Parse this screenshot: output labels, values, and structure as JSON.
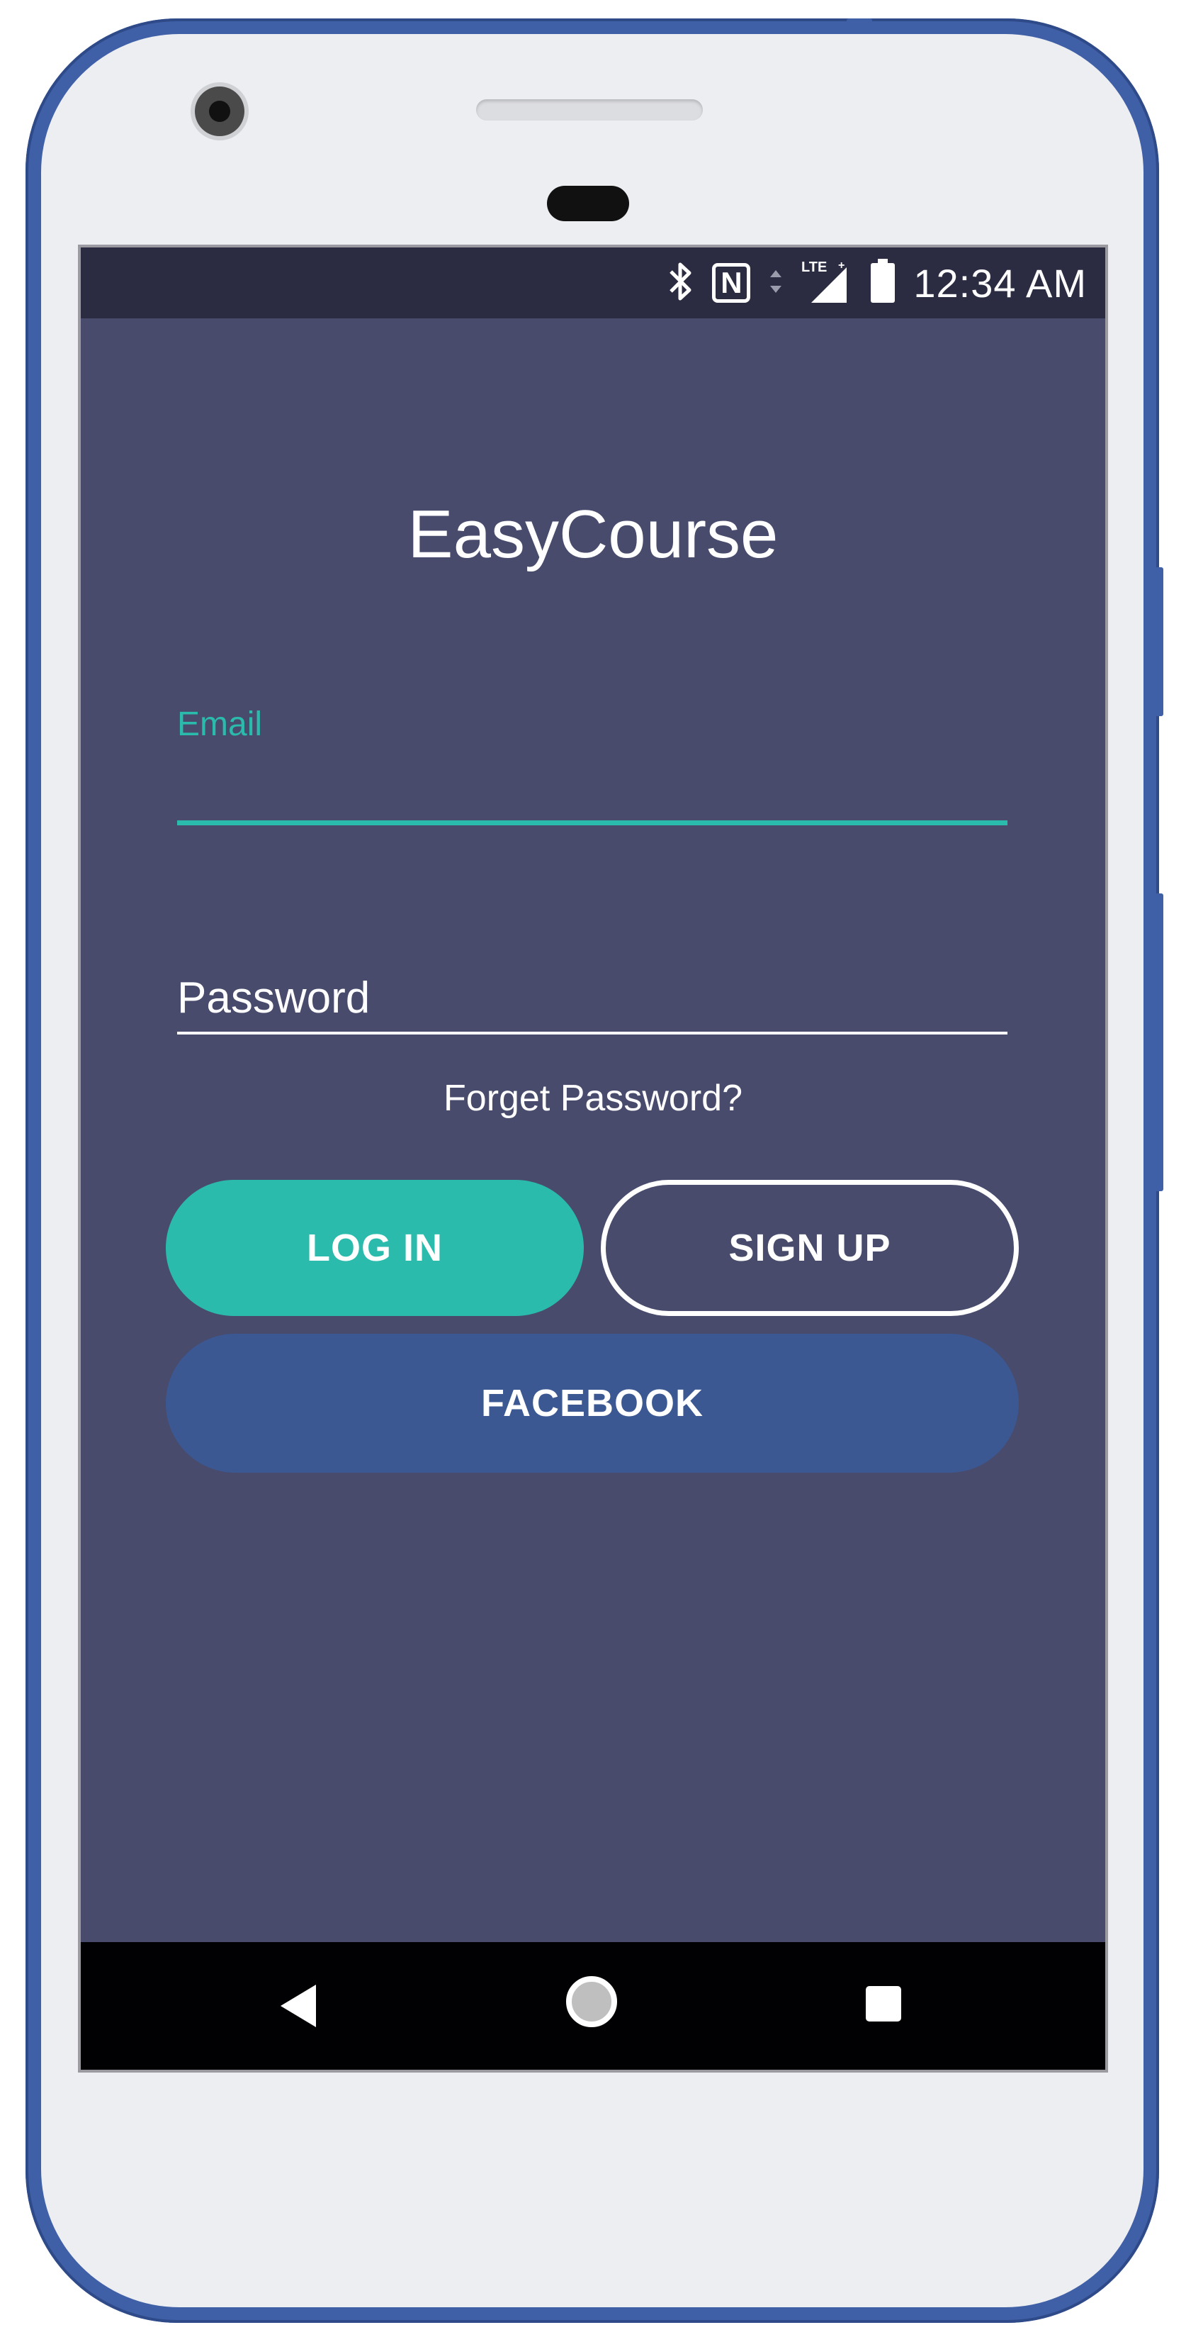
{
  "status_bar": {
    "time": "12:34 AM",
    "network": "LTE",
    "icons": [
      "bluetooth-icon",
      "nfc-icon",
      "data-arrows-icon",
      "lte-signal-icon",
      "battery-icon"
    ]
  },
  "app": {
    "title": "EasyCourse"
  },
  "form": {
    "email_label": "Email",
    "email_value": "",
    "password_placeholder": "Password",
    "forget_password": "Forget Password?"
  },
  "buttons": {
    "login": "LOG IN",
    "signup": "SIGN UP",
    "facebook": "FACEBOOK"
  },
  "nav_bar": {
    "icons": [
      "back-icon",
      "home-icon",
      "recents-icon"
    ]
  },
  "colors": {
    "background": "#484b6c",
    "status_bar": "#2b2c42",
    "accent": "#2bbbad",
    "facebook": "#3b5893",
    "device_frame": "#3f5fa7"
  }
}
